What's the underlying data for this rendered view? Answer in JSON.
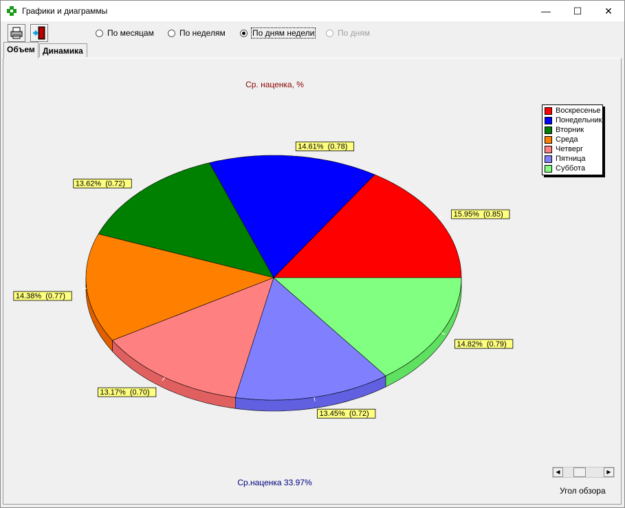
{
  "window": {
    "title": "Графики и диаграммы"
  },
  "titlebar": {
    "minimize": "—",
    "maximize": "☐",
    "close": "✕"
  },
  "toolbar": {
    "print_icon": "printer-icon",
    "exit_icon": "exit-door-icon"
  },
  "period_options": [
    {
      "label": "По месяцам",
      "checked": false,
      "enabled": true
    },
    {
      "label": "По неделям",
      "checked": false,
      "enabled": true
    },
    {
      "label": "По дням недели",
      "checked": true,
      "enabled": true
    },
    {
      "label": "По дням",
      "checked": false,
      "enabled": false
    }
  ],
  "tabs": [
    {
      "label": "Объем",
      "active": true
    },
    {
      "label": "Динамика",
      "active": false
    }
  ],
  "chart_data": {
    "type": "pie",
    "title": "Ср. наценка, %",
    "footer": "Ср.наценка 33.97%",
    "categories": [
      "Воскресенье",
      "Понедельник",
      "Вторник",
      "Среда",
      "Четверг",
      "Пятница",
      "Суббота"
    ],
    "percents": [
      15.95,
      14.61,
      13.62,
      14.38,
      13.17,
      13.45,
      14.82
    ],
    "values": [
      0.85,
      0.78,
      0.72,
      0.77,
      0.7,
      0.72,
      0.79
    ],
    "labels": [
      "15.95%  (0.85)",
      "14.61%  (0.78)",
      "13.62%  (0.72)",
      "14.38%  (0.77)",
      "13.17%  (0.70)",
      "13.45%  (0.72)",
      "14.82%  (0.79)"
    ],
    "colors": [
      "#ff0000",
      "#0000ff",
      "#008000",
      "#ff8000",
      "#ff8080",
      "#8080ff",
      "#80ff80"
    ],
    "side_colors": [
      "#cc0000",
      "#0000cc",
      "#006000",
      "#e06000",
      "#e06060",
      "#6060e0",
      "#60e060"
    ],
    "legend_position": "top-right",
    "three_d": true
  },
  "view_angle": {
    "label": "Угол обзора"
  }
}
